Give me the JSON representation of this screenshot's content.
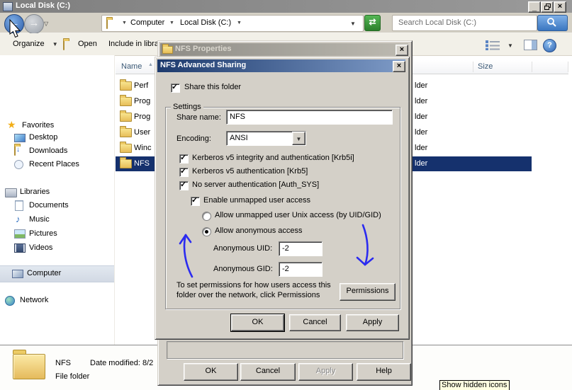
{
  "colors": {
    "selection_navy": "#15316d",
    "active_title_left": "#1d3a6d",
    "active_title_right": "#7e9bc7",
    "annotation_blue": "#2b2bf0",
    "dialog_face": "#d4d0c8"
  },
  "window": {
    "title": "Local Disk (C:)"
  },
  "address_bar": {
    "crumb_root": "Computer",
    "crumb_current": "Local Disk (C:)",
    "search_text": "Search Local Disk (C:)"
  },
  "toolbar": {
    "organize": "Organize",
    "open": "Open",
    "include": "Include in libra"
  },
  "sidebar": {
    "favorites_label": "Favorites",
    "favorites_items": [
      "Desktop",
      "Downloads",
      "Recent Places"
    ],
    "libraries_label": "Libraries",
    "libraries_items": [
      "Documents",
      "Music",
      "Pictures",
      "Videos"
    ],
    "computer_label": "Computer",
    "network_label": "Network"
  },
  "file_list": {
    "columns": {
      "name": "Name",
      "size": "Size"
    },
    "rows": [
      {
        "name": "Perf",
        "type_tail": "lder"
      },
      {
        "name": "Prog",
        "type_tail": "lder"
      },
      {
        "name": "Prog",
        "type_tail": "lder"
      },
      {
        "name": "User",
        "type_tail": "lder"
      },
      {
        "name": "Winc",
        "type_tail": "lder"
      },
      {
        "name": "NFS",
        "type_tail": "lder"
      }
    ],
    "selected_row": "NFS"
  },
  "details_pane": {
    "name": "NFS",
    "date_modified": "Date modified: 8/2",
    "type": "File folder"
  },
  "properties_dialog": {
    "title": "NFS Properties",
    "ok": "OK",
    "cancel": "Cancel",
    "apply": "Apply",
    "help": "Help"
  },
  "advanced_dialog": {
    "title": "NFS Advanced Sharing",
    "share_this_folder": "Share this folder",
    "settings": "Settings",
    "share_name_label": "Share name:",
    "share_name_value": "NFS",
    "encoding_label": "Encoding:",
    "encoding_value": "ANSI",
    "checkboxes": [
      {
        "label": "Kerberos v5 integrity and authentication [Krb5i]",
        "checked": true
      },
      {
        "label": "Kerberos v5 authentication [Krb5]",
        "checked": true
      },
      {
        "label": "No server authentication [Auth_SYS]",
        "checked": true
      },
      {
        "label": "Enable unmapped user access",
        "checked": true
      }
    ],
    "radios": [
      {
        "label": "Allow unmapped user Unix access (by UID/GID)",
        "selected": false
      },
      {
        "label": "Allow anonymous access",
        "selected": true
      }
    ],
    "anon_uid_label": "Anonymous UID:",
    "anon_uid_value": "-2",
    "anon_gid_label": "Anonymous GID:",
    "anon_gid_value": "-2",
    "permissions_note_line1": "To set permissions for how users access this",
    "permissions_note_line2": "folder over the network, click Permissions",
    "permissions_button": "Permissions",
    "ok": "OK",
    "cancel": "Cancel",
    "apply": "Apply"
  },
  "tooltip": {
    "text": "Show hidden icons"
  }
}
